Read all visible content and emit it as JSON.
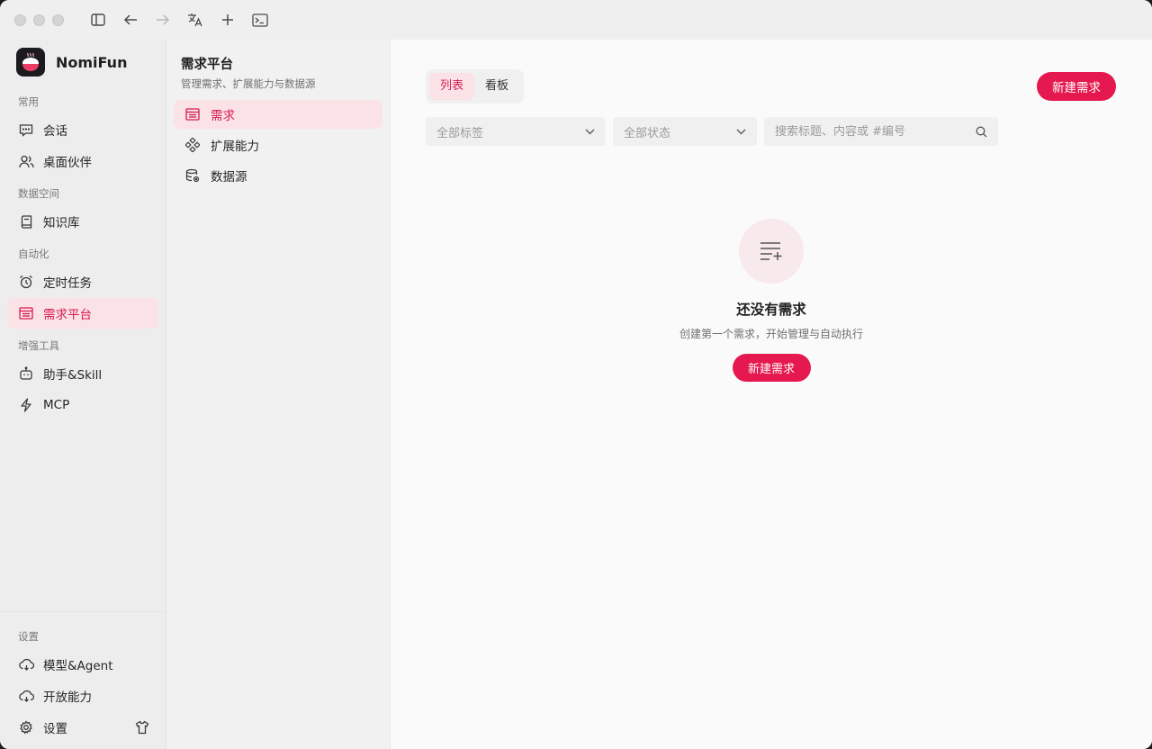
{
  "app": {
    "name": "NomiFun",
    "accent": "#e5184f"
  },
  "titlebar": {
    "icons": [
      "sidebar-toggle-icon",
      "back-arrow-icon",
      "forward-arrow-icon",
      "translate-icon",
      "plus-icon",
      "terminal-icon"
    ]
  },
  "sidebar": {
    "sections": [
      {
        "label": "常用",
        "items": [
          {
            "label": "会话",
            "icon": "chat-icon"
          },
          {
            "label": "桌面伙伴",
            "icon": "users-icon"
          }
        ]
      },
      {
        "label": "数据空间",
        "items": [
          {
            "label": "知识库",
            "icon": "book-icon"
          }
        ]
      },
      {
        "label": "自动化",
        "items": [
          {
            "label": "定时任务",
            "icon": "alarm-icon"
          },
          {
            "label": "需求平台",
            "icon": "list-icon",
            "active": true
          }
        ]
      },
      {
        "label": "增强工具",
        "items": [
          {
            "label": "助手&Skill",
            "icon": "robot-icon"
          },
          {
            "label": "MCP",
            "icon": "bolt-icon"
          }
        ]
      }
    ],
    "bottom": {
      "label": "设置",
      "items": [
        {
          "label": "模型&Agent",
          "icon": "cloud-icon"
        },
        {
          "label": "开放能力",
          "icon": "cloud-icon"
        },
        {
          "label": "设置",
          "icon": "gear-icon"
        }
      ]
    }
  },
  "subpanel": {
    "title": "需求平台",
    "description": "管理需求、扩展能力与数据源",
    "items": [
      {
        "label": "需求",
        "icon": "list-icon",
        "active": true
      },
      {
        "label": "扩展能力",
        "icon": "extension-icon"
      },
      {
        "label": "数据源",
        "icon": "database-icon"
      }
    ]
  },
  "main": {
    "view_tabs": [
      {
        "label": "列表",
        "active": true
      },
      {
        "label": "看板"
      }
    ],
    "new_button": "新建需求",
    "filters": {
      "tags_placeholder": "全部标签",
      "status_placeholder": "全部状态",
      "search_placeholder": "搜索标题、内容或 #编号"
    },
    "empty_state": {
      "title": "还没有需求",
      "description": "创建第一个需求，开始管理与自动执行",
      "button": "新建需求"
    }
  }
}
